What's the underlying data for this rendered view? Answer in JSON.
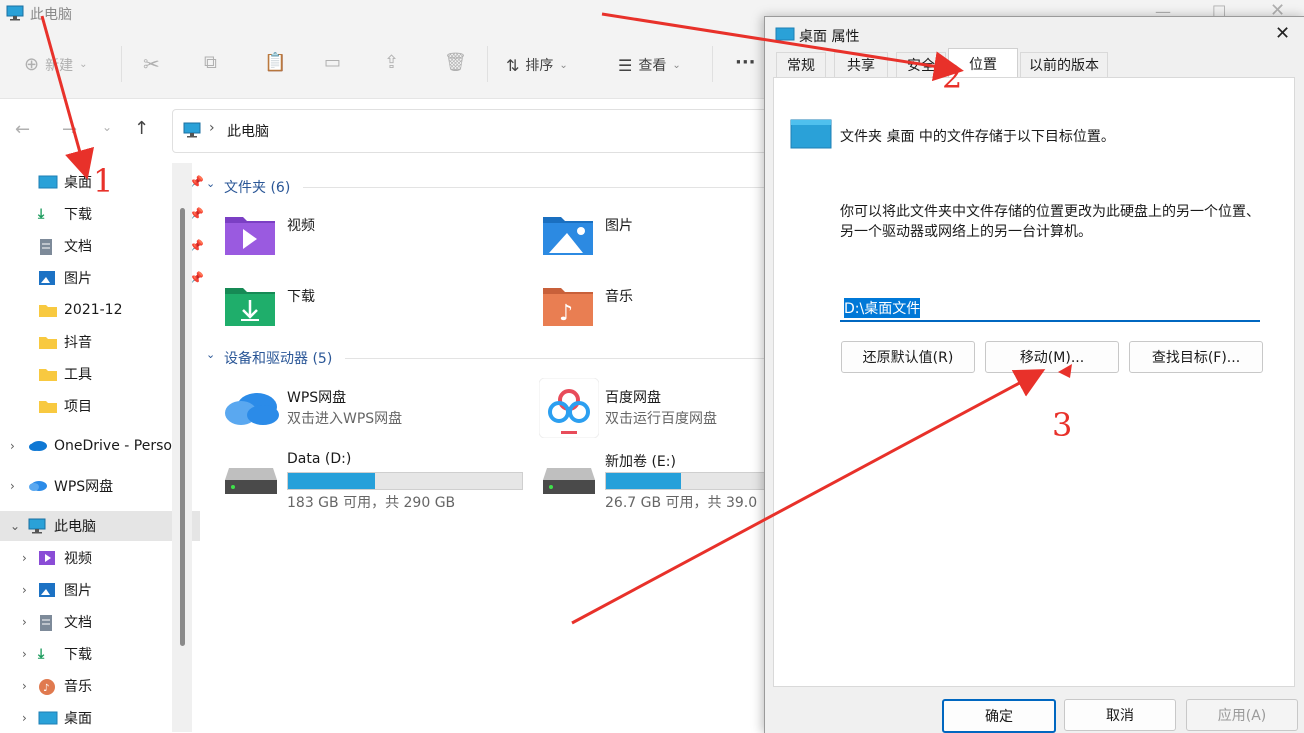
{
  "window": {
    "title": "此电脑"
  },
  "toolbar": {
    "new": "新建",
    "sort": "排序",
    "view": "查看",
    "more": "···"
  },
  "address": {
    "path": "此电脑"
  },
  "sidebar": {
    "quick": [
      {
        "label": "桌面",
        "icon": "desktop-icon",
        "pinned": true
      },
      {
        "label": "下载",
        "icon": "download-icon",
        "pinned": true
      },
      {
        "label": "文档",
        "icon": "document-icon",
        "pinned": true
      },
      {
        "label": "图片",
        "icon": "picture-icon",
        "pinned": true
      },
      {
        "label": "2021-12",
        "icon": "folder-icon",
        "pinned": false
      },
      {
        "label": "抖音",
        "icon": "folder-icon",
        "pinned": false
      },
      {
        "label": "工具",
        "icon": "folder-icon",
        "pinned": false
      },
      {
        "label": "项目",
        "icon": "folder-icon",
        "pinned": false
      }
    ],
    "onedrive": "OneDrive - Perso",
    "wps": "WPS网盘",
    "thispc": "此电脑",
    "pc_children": [
      "视频",
      "图片",
      "文档",
      "下载",
      "音乐",
      "桌面"
    ]
  },
  "content": {
    "folders_header": "文件夹 (6)",
    "folders": [
      "视频",
      "图片",
      "下载",
      "音乐"
    ],
    "devices_header": "设备和驱动器 (5)",
    "wps": {
      "name": "WPS网盘",
      "desc": "双击进入WPS网盘"
    },
    "baidu": {
      "name": "百度网盘",
      "desc": "双击运行百度网盘"
    },
    "drive_d": {
      "name": "Data (D:)",
      "space": "183 GB 可用，共 290 GB",
      "used_fraction": 0.37
    },
    "drive_e": {
      "name": "新加卷 (E:)",
      "space": "26.7 GB 可用，共 39.0",
      "used_fraction": 0.32
    }
  },
  "dialog": {
    "title": "桌面 属性",
    "tabs": [
      "常规",
      "共享",
      "安全",
      "位置",
      "以前的版本"
    ],
    "heading": "文件夹 桌面 中的文件存储于以下目标位置。",
    "desc": "你可以将此文件夹中文件存储的位置更改为此硬盘上的另一个位置、另一个驱动器或网络上的另一台计算机。",
    "path": "D:\\桌面文件",
    "restore": "还原默认值(R)",
    "move": "移动(M)...",
    "find": "查找目标(F)...",
    "ok": "确定",
    "cancel": "取消",
    "apply": "应用(A)"
  },
  "annotations": {
    "n1": "1",
    "n2": "2",
    "n3": "3"
  },
  "colors": {
    "accent": "#0067c0",
    "annotation": "#e8312a"
  }
}
